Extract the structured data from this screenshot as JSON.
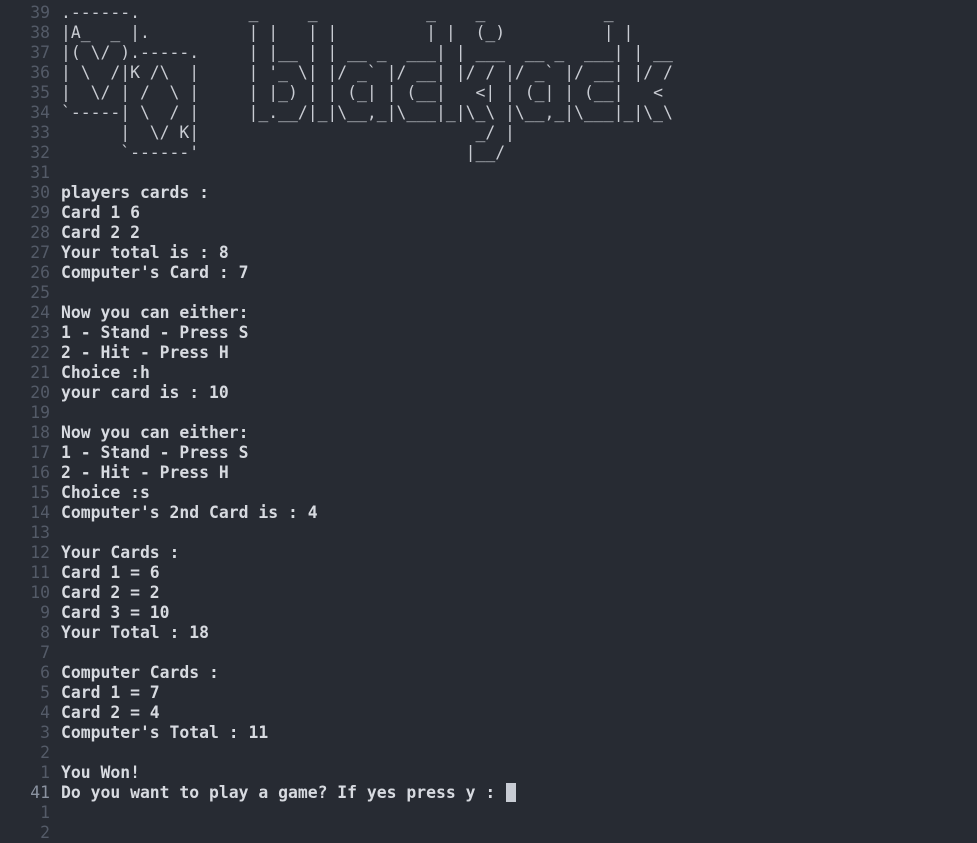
{
  "ascii_art": {
    "line_numbers": [
      "39",
      "38",
      "37",
      "36",
      "35",
      "34",
      "33",
      "32"
    ],
    "lines": [
      ".------.           _     _           _    _            _",
      "|A_  _ |.          | |   | |         | |  (_)          | |",
      "|( \\/ ).-----.     | |__ | | __ _  ___| | ___  __ _  ___| | __",
      "| \\  /|K /\\  |     | '_ \\| |/ _` |/ __| |/ / |/ _` |/ __| |/ /",
      "|  \\/ | /  \\ |     | |_) | | (_| | (__|   <| | (_| | (__|   <",
      "`-----| \\  / |     |_.__/|_|\\__,_|\\___|_|\\_\\ |\\__,_|\\___|_|\\_\\",
      "      |  \\/ K|                            _/ |",
      "      `------'                           |__/"
    ]
  },
  "output": {
    "l31": {
      "n": "31",
      "t": ""
    },
    "l30": {
      "n": "30",
      "t": "players cards :"
    },
    "l29": {
      "n": "29",
      "t": "Card 1 6"
    },
    "l28": {
      "n": "28",
      "t": "Card 2 2"
    },
    "l27": {
      "n": "27",
      "t": "Your total is : 8"
    },
    "l26": {
      "n": "26",
      "t": "Computer's Card : 7"
    },
    "l25": {
      "n": "25",
      "t": ""
    },
    "l24": {
      "n": "24",
      "t": "Now you can either:"
    },
    "l23": {
      "n": "23",
      "t": "1 - Stand - Press S"
    },
    "l22": {
      "n": "22",
      "t": "2 - Hit - Press H"
    },
    "l21": {
      "n": "21",
      "t": "Choice :h"
    },
    "l20": {
      "n": "20",
      "t": "your card is : 10"
    },
    "l19": {
      "n": "19",
      "t": ""
    },
    "l18": {
      "n": "18",
      "t": "Now you can either:"
    },
    "l17": {
      "n": "17",
      "t": "1 - Stand - Press S"
    },
    "l16": {
      "n": "16",
      "t": "2 - Hit - Press H"
    },
    "l15": {
      "n": "15",
      "t": "Choice :s"
    },
    "l14": {
      "n": "14",
      "t": "Computer's 2nd Card is : 4"
    },
    "l13": {
      "n": "13",
      "t": ""
    },
    "l12": {
      "n": "12",
      "t": "Your Cards :"
    },
    "l11": {
      "n": "11",
      "t": "Card 1 = 6"
    },
    "l10": {
      "n": "10",
      "t": "Card 2 = 2"
    },
    "l9": {
      "n": "9",
      "t": "Card 3 = 10"
    },
    "l8": {
      "n": "8",
      "t": "Your Total : 18"
    },
    "l7": {
      "n": "7",
      "t": ""
    },
    "l6": {
      "n": "6",
      "t": "Computer Cards :"
    },
    "l5": {
      "n": "5",
      "t": "Card 1 = 7"
    },
    "l4": {
      "n": "4",
      "t": "Card 2 = 4"
    },
    "l3": {
      "n": "3",
      "t": "Computer's Total : 11"
    },
    "l2": {
      "n": "2",
      "t": ""
    },
    "l1": {
      "n": "1",
      "t": "You Won!"
    }
  },
  "prompt": {
    "line_number": "41",
    "text": "Do you want to play a game? If yes press y : "
  },
  "after": {
    "l1": {
      "n": "1",
      "t": ""
    },
    "l2": {
      "n": "2",
      "t": ""
    }
  },
  "colors": {
    "background": "#272b33",
    "text": "#d7dae0",
    "line_number": "#545b68",
    "current_line_number": "#8b93a1",
    "cursor": "#c8ccd4"
  }
}
